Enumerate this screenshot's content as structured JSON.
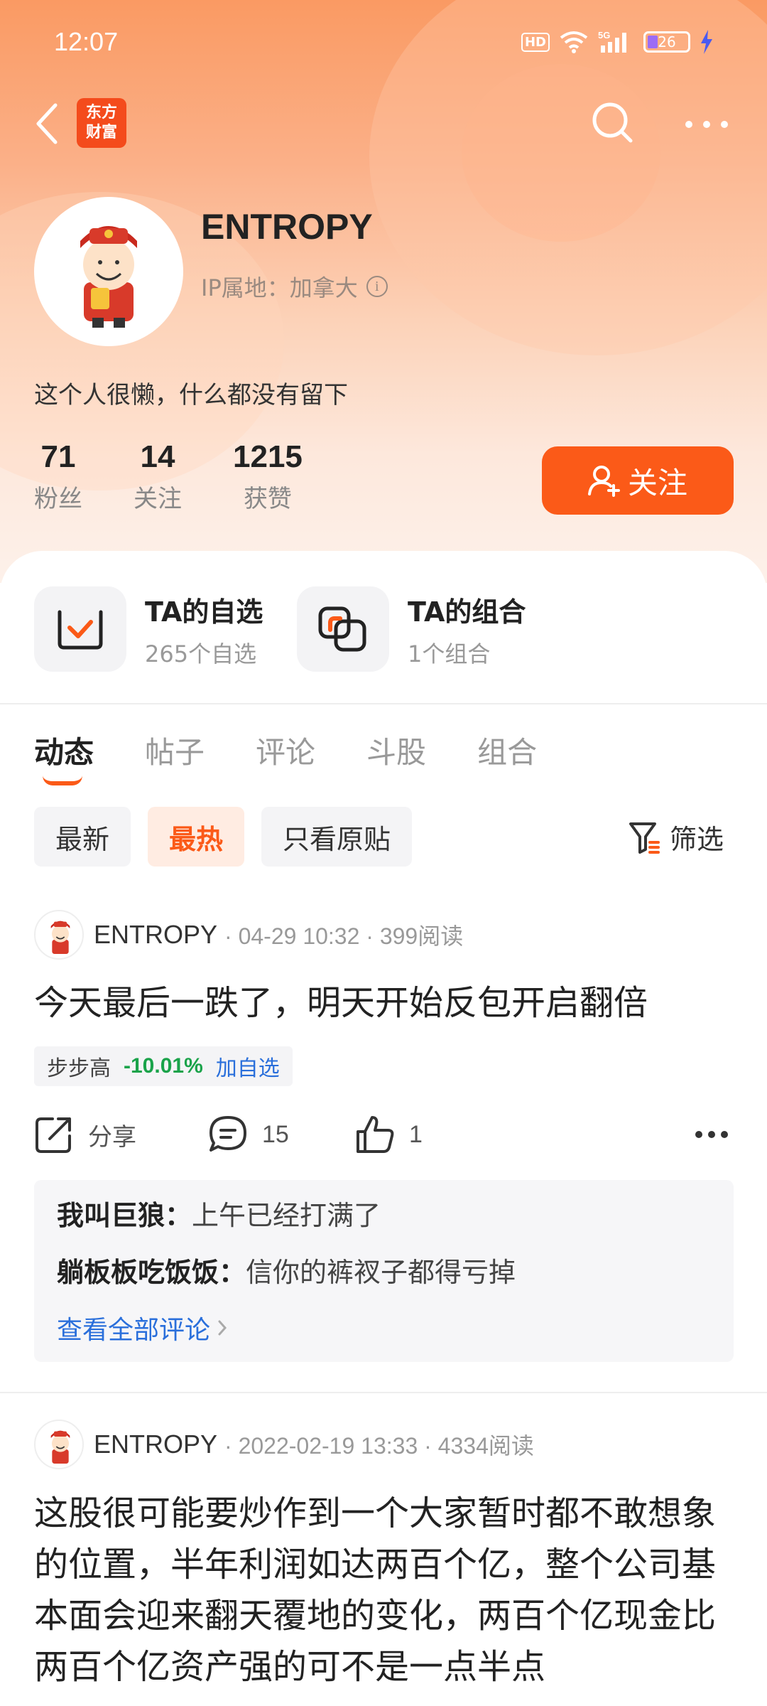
{
  "status_bar": {
    "time": "12:07",
    "hd": "HD",
    "network": "5G",
    "battery": "26"
  },
  "nav": {
    "logo_line1": "东方",
    "logo_line2": "财富"
  },
  "profile": {
    "name": "ENTROPY",
    "ip_label": "IP属地：加拿大",
    "bio": "这个人很懒，什么都没有留下",
    "stats": [
      {
        "num": "71",
        "label": "粉丝"
      },
      {
        "num": "14",
        "label": "关注"
      },
      {
        "num": "1215",
        "label": "获赞"
      }
    ],
    "follow_label": "关注"
  },
  "quick_links": [
    {
      "title": "TA的自选",
      "sub": "265个自选",
      "icon": "watchlist-check-icon"
    },
    {
      "title": "TA的组合",
      "sub": "1个组合",
      "icon": "portfolio-icon"
    }
  ],
  "tabs": [
    "动态",
    "帖子",
    "评论",
    "斗股",
    "组合"
  ],
  "filters": [
    "最新",
    "最热",
    "只看原贴"
  ],
  "filter_btn": "筛选",
  "posts": [
    {
      "user": "ENTROPY",
      "meta": "· 04-29 10:32 · 399阅读",
      "text": "今天最后一跌了，明天开始反包开启翻倍",
      "stock": {
        "name": "步步高",
        "change": "-10.01%",
        "add": "加自选"
      },
      "share": "分享",
      "comments": "15",
      "likes": "1",
      "replies": [
        {
          "user": "我叫巨狼：",
          "text": "上午已经打满了"
        },
        {
          "user": "躺板板吃饭饭：",
          "text": "信你的裤衩子都得亏掉"
        }
      ],
      "see_all": "查看全部评论"
    },
    {
      "user": "ENTROPY",
      "meta": "· 2022-02-19 13:33 · 4334阅读",
      "text": "这股很可能要炒作到一个大家暂时都不敢想象的位置，半年利润如达两百个亿，整个公司基本面会迎来翻天覆地的变化，两百个亿现金比两百个亿资产强的可不是一点半点"
    }
  ],
  "colors": {
    "accent": "#fb5a18",
    "down_green": "#1aa34a",
    "link_blue": "#2a6fdb"
  }
}
